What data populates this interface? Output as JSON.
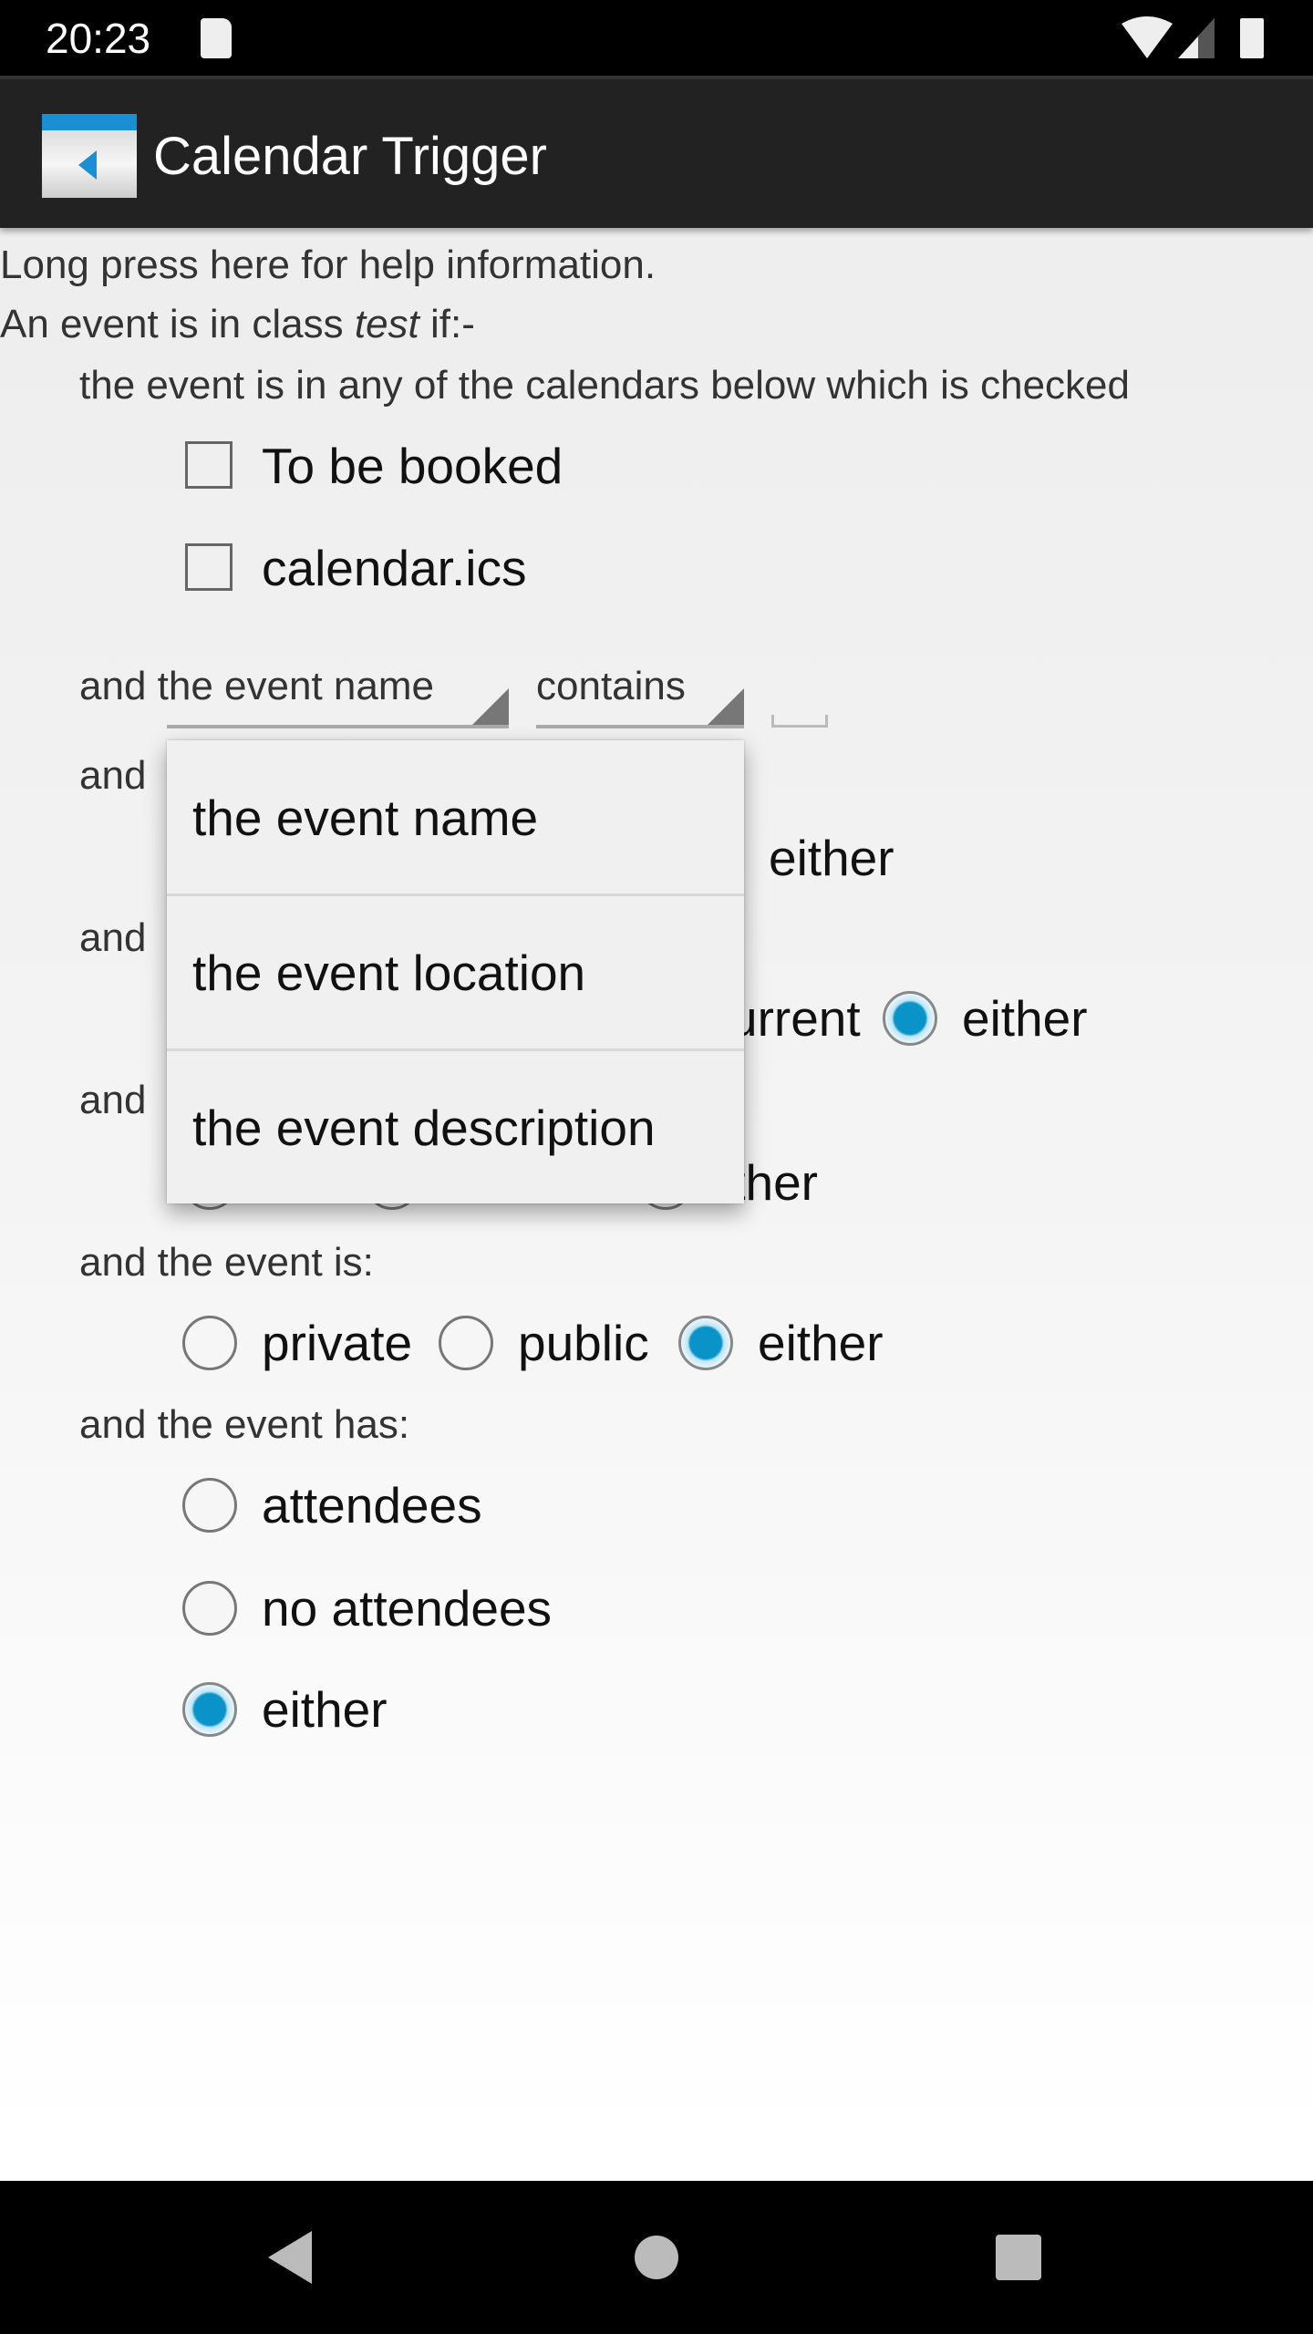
{
  "status_bar": {
    "time": "20:23",
    "icons": [
      "sd-card-icon",
      "wifi-icon",
      "signal-icon",
      "battery-icon"
    ]
  },
  "action_bar": {
    "title": "Calendar Trigger",
    "icon": "calendar-mute-icon"
  },
  "help_text": "Long press here for help information.",
  "class_intro": {
    "prefix": "An event is in class ",
    "class_name": "test",
    "suffix": " if:-"
  },
  "calendars": {
    "label": "the event is in any of the calendars below which is checked",
    "items": [
      {
        "label": "To be booked",
        "checked": false
      },
      {
        "label": "calendar.ics",
        "checked": false
      }
    ]
  },
  "match": {
    "field_spinner": "and the event name",
    "op_spinner": "contains",
    "value": ""
  },
  "popup": {
    "options": [
      "the event name",
      "the event location",
      "the event description"
    ]
  },
  "partial_rows": [
    {
      "label": "and",
      "visible_text": "either"
    },
    {
      "label": "and",
      "visible_text_1": "urrent",
      "visible_text_2": "either",
      "checked": true
    },
    {
      "label": "and",
      "visible_text": "ither"
    }
  ],
  "visibility": {
    "label": "and the event is:",
    "options": [
      {
        "label": "private",
        "checked": false
      },
      {
        "label": "public",
        "checked": false
      },
      {
        "label": "either",
        "checked": true
      }
    ]
  },
  "attendees": {
    "label": "and the event has:",
    "options": [
      {
        "label": "attendees",
        "checked": false
      },
      {
        "label": "no attendees",
        "checked": false
      },
      {
        "label": "either",
        "checked": true
      }
    ]
  },
  "colors": {
    "accent": "#0a93c9",
    "action_bar": "#222222",
    "status_bar": "#000000"
  }
}
